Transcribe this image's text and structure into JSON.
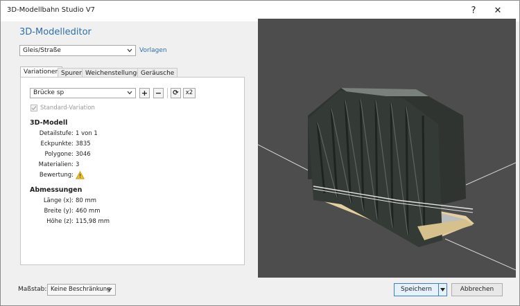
{
  "window": {
    "title": "3D-Modellbahn Studio V7",
    "help_glyph": "?",
    "close_glyph": "✕"
  },
  "editor": {
    "heading": "3D-Modelleditor",
    "category_select": "Gleis/Straße",
    "vorlagen_link": "Vorlagen",
    "tabs": [
      "Variationen",
      "Spuren",
      "Weichenstellungen",
      "Geräusche"
    ],
    "active_tab_index": 0,
    "variation_select": "Brücke sp",
    "toolbar": {
      "add_glyph": "+",
      "remove_glyph": "−",
      "refresh_glyph": "⟳",
      "x2_label": "x2"
    },
    "standard_variation": {
      "label": "Standard-Variation",
      "checked": true,
      "disabled": true
    },
    "model_section": {
      "title": "3D-Modell",
      "rows": [
        {
          "label": "Detailstufe:",
          "value": "1 von 1"
        },
        {
          "label": "Eckpunkte:",
          "value": "3835"
        },
        {
          "label": "Polygone:",
          "value": "3046"
        },
        {
          "label": "Materialien:",
          "value": "3"
        },
        {
          "label": "Bewertung:",
          "value": ""
        }
      ],
      "warning_icon": "warning-icon"
    },
    "dimensions_section": {
      "title": "Abmessungen",
      "rows": [
        {
          "label": "Länge (x):",
          "value": "80 mm"
        },
        {
          "label": "Breite (y):",
          "value": "460 mm"
        },
        {
          "label": "Höhe (z):",
          "value": "115,98 mm"
        }
      ]
    }
  },
  "footer": {
    "scale_label": "Maßstab:",
    "scale_select": "Keine Beschränkung",
    "save_button": "Speichern",
    "cancel_button": "Abbrechen"
  },
  "colors": {
    "accent": "#2f6fa8",
    "viewport_bg": "#4d4d4d",
    "bridge_steel": "#2f3431",
    "deck_wood": "#e4cf9e",
    "warning": "#f0c020"
  }
}
